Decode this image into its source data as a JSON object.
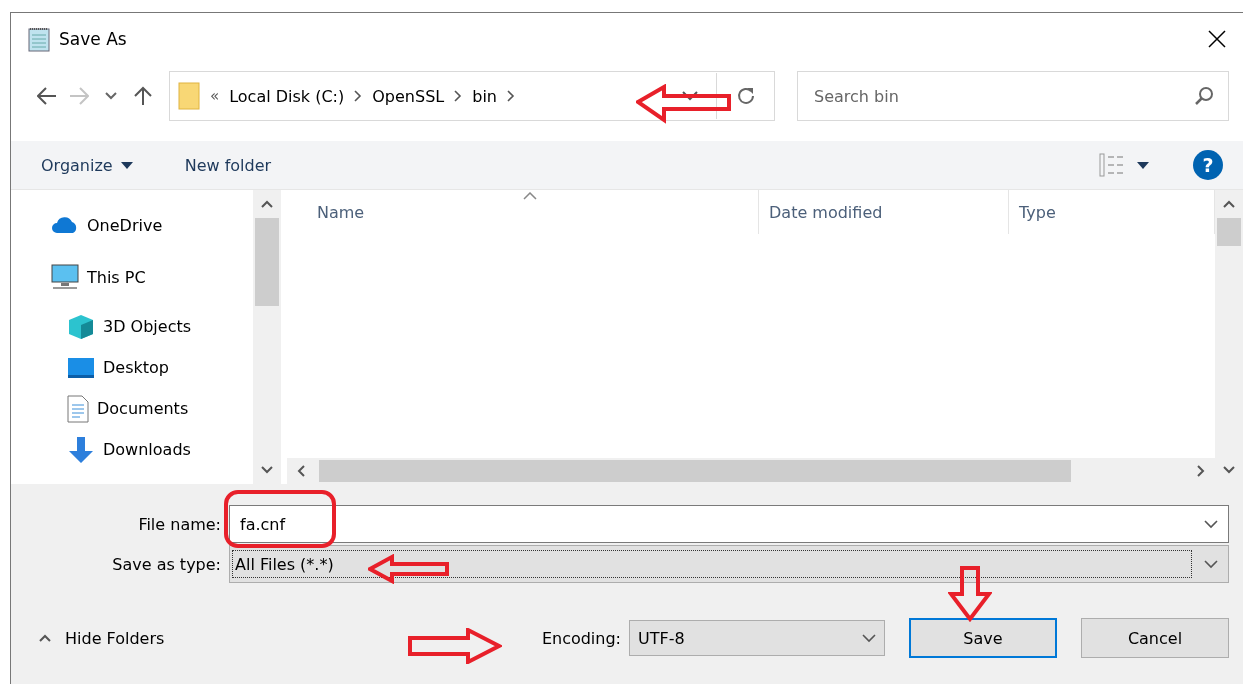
{
  "window": {
    "title": "Save As"
  },
  "address": {
    "overflow": "«",
    "crumbs": [
      "Local Disk (C:)",
      "OpenSSL",
      "bin"
    ]
  },
  "search": {
    "placeholder": "Search bin"
  },
  "toolbar": {
    "organize": "Organize",
    "new_folder": "New folder",
    "help": "?"
  },
  "sidebar": {
    "items": [
      {
        "label": "OneDrive",
        "kind": "cloud"
      },
      {
        "label": "This PC",
        "kind": "pc",
        "children": [
          {
            "label": "3D Objects",
            "kind": "cube"
          },
          {
            "label": "Desktop",
            "kind": "desktop"
          },
          {
            "label": "Documents",
            "kind": "docs"
          },
          {
            "label": "Downloads",
            "kind": "download"
          }
        ]
      }
    ]
  },
  "table": {
    "columns": [
      "Name",
      "Date modified",
      "Type"
    ]
  },
  "form": {
    "file_name_label": "File name:",
    "file_name": "fa.cnf",
    "type_label": "Save as type:",
    "type_value": "All Files  (*.*)"
  },
  "footer": {
    "hide_folders": "Hide Folders",
    "encoding_label": "Encoding:",
    "encoding": "UTF-8",
    "save": "Save",
    "cancel": "Cancel"
  }
}
